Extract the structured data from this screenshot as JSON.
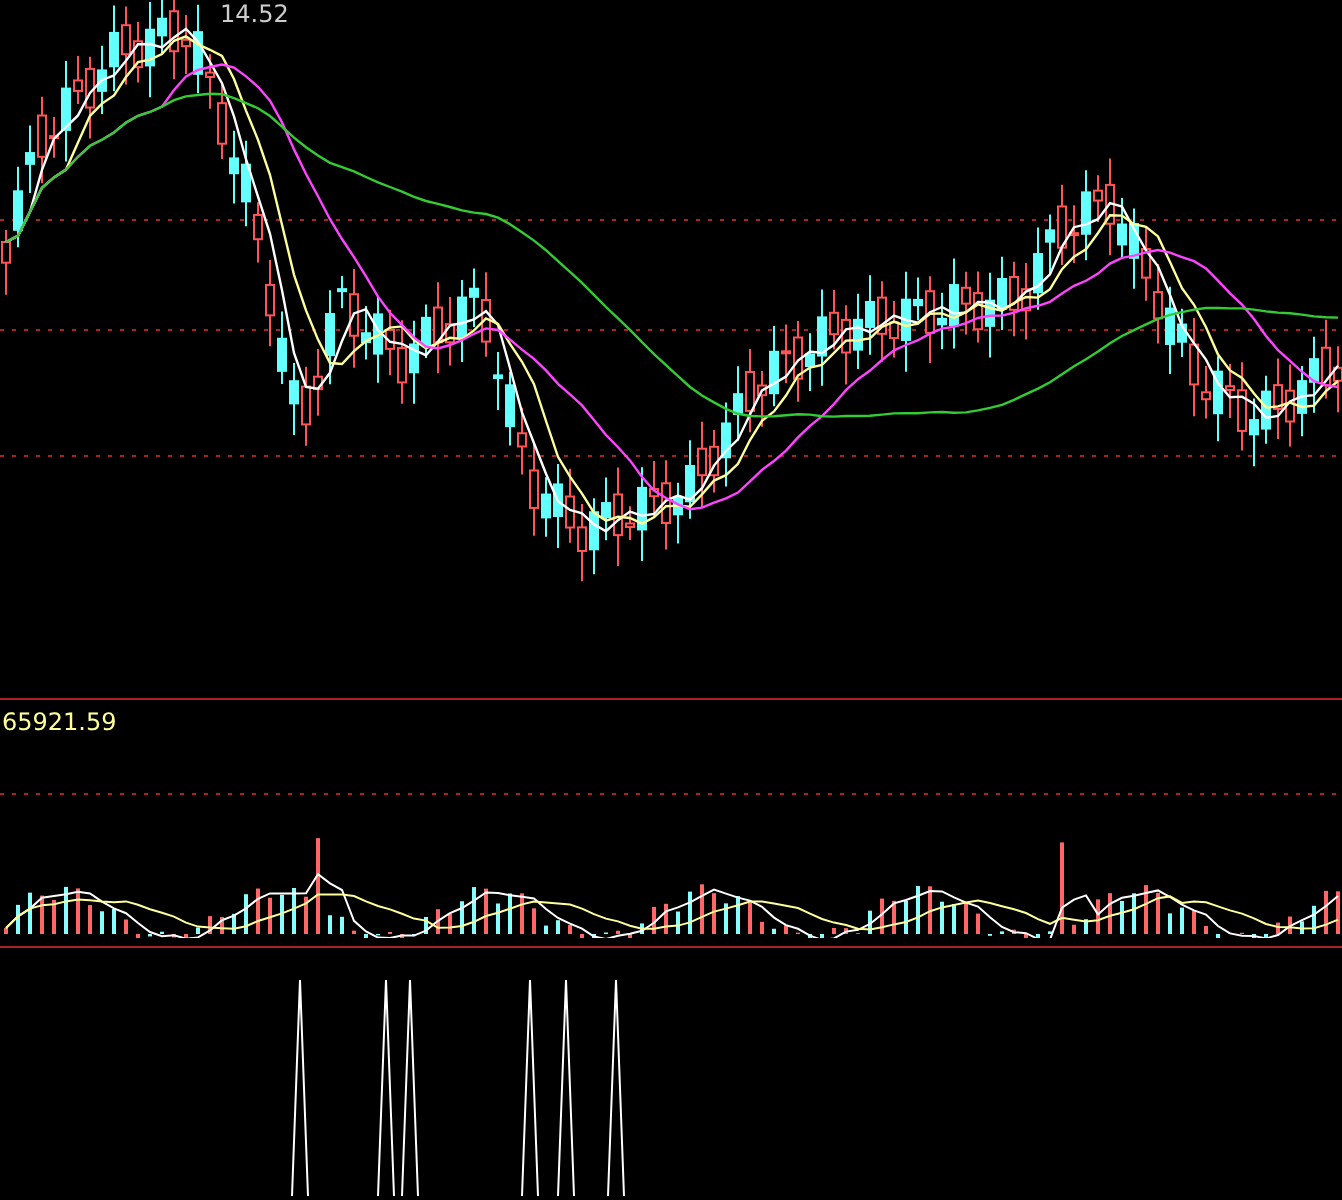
{
  "price_panel": {
    "high_label": "14.52"
  },
  "volume_panel": {
    "value_label": "65921.59"
  }
}
